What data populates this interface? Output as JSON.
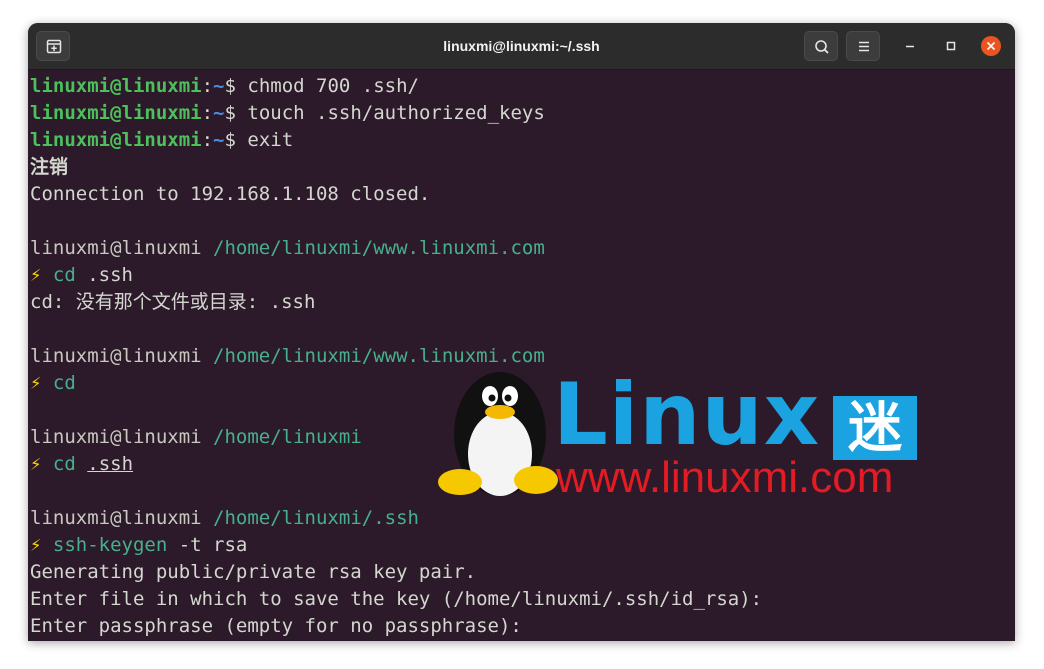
{
  "window": {
    "title": "linuxmi@linuxmi:~/.ssh"
  },
  "icons": {
    "new_tab": "new-tab-icon",
    "search": "search-icon",
    "menu": "hamburger-menu-icon",
    "minimize": "minimize-icon",
    "maximize": "maximize-icon",
    "close": "close-icon"
  },
  "colors": {
    "terminal_bg": "#2c1a2a",
    "prompt_user": "#4cc05a",
    "prompt_path": "#4a8ee0",
    "zsh_path": "#46b08c",
    "bolt": "#f5d20a",
    "close_btn": "#e95420"
  },
  "terminal": {
    "lines": {
      "l1": {
        "user": "linuxmi@linuxmi",
        "colon": ":",
        "tilde": "~",
        "dollar": "$ ",
        "cmd": "chmod 700 .ssh/"
      },
      "l2": {
        "user": "linuxmi@linuxmi",
        "colon": ":",
        "tilde": "~",
        "dollar": "$ ",
        "cmd": "touch .ssh/authorized_keys"
      },
      "l3": {
        "user": "linuxmi@linuxmi",
        "colon": ":",
        "tilde": "~",
        "dollar": "$ ",
        "cmd": "exit"
      },
      "l4": {
        "text": "注销"
      },
      "l5": {
        "text": "Connection to 192.168.1.108 closed."
      },
      "l6": {
        "host": "linuxmi@linuxmi",
        "path": "/home/linuxmi/www.linuxmi.com"
      },
      "l7": {
        "bolt": "⚡",
        "cmd": "cd",
        "arg": " .ssh"
      },
      "l8": {
        "text": "cd: 没有那个文件或目录: .ssh"
      },
      "l9": {
        "host": "linuxmi@linuxmi",
        "path": "/home/linuxmi/www.linuxmi.com"
      },
      "l10": {
        "bolt": "⚡",
        "cmd": "cd"
      },
      "l11": {
        "host": "linuxmi@linuxmi",
        "path": "/home/linuxmi"
      },
      "l12": {
        "bolt": "⚡",
        "cmd": "cd",
        "arg": ".ssh"
      },
      "l13": {
        "host": "linuxmi@linuxmi",
        "path": "/home/linuxmi/.ssh"
      },
      "l14": {
        "bolt": "⚡",
        "cmd": "ssh-keygen",
        "arg": " -t rsa"
      },
      "l15": {
        "text": "Generating public/private rsa key pair."
      },
      "l16": {
        "text": "Enter file in which to save the key (/home/linuxmi/.ssh/id_rsa):"
      },
      "l17": {
        "text": "Enter passphrase (empty for no passphrase):"
      }
    }
  },
  "watermark": {
    "brand": "Linux",
    "brand_cn": "迷",
    "url": "www.linuxmi.com"
  }
}
